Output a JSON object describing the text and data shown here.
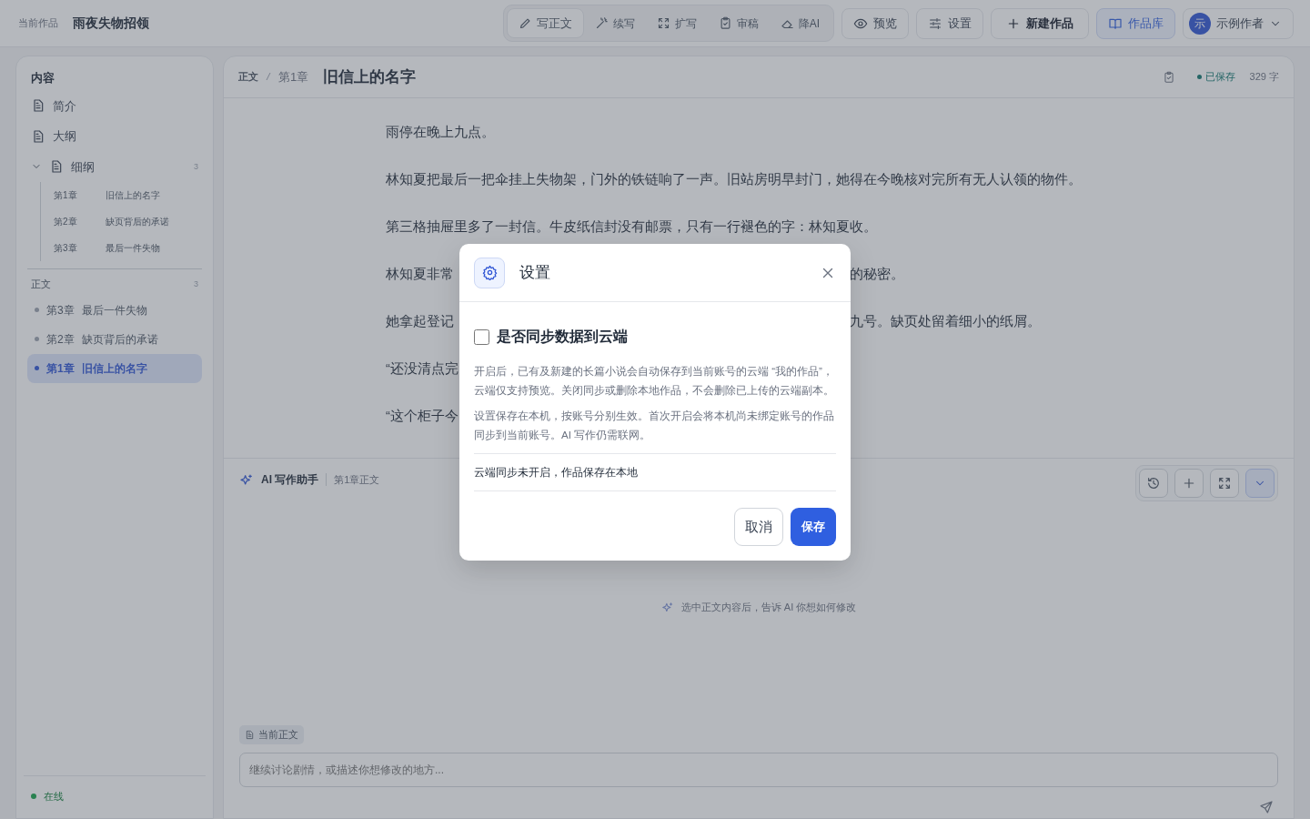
{
  "topbar": {
    "label": "当前作品",
    "work_title": "雨夜失物招领",
    "tools": [
      {
        "label": "写正文",
        "selected": true
      },
      {
        "label": "续写",
        "selected": false
      },
      {
        "label": "扩写",
        "selected": false
      },
      {
        "label": "审稿",
        "selected": false
      },
      {
        "label": "降AI",
        "selected": false
      }
    ],
    "buttons": [
      {
        "label": "预览",
        "kind": "plain"
      },
      {
        "label": "设置",
        "kind": "plain"
      },
      {
        "label": "新建作品",
        "kind": "bold"
      },
      {
        "label": "作品库",
        "kind": "primary"
      }
    ],
    "user": {
      "avatar": "示",
      "name": "示例作者"
    }
  },
  "sidebar": {
    "title": "内容",
    "docs": [
      {
        "label": "简介"
      },
      {
        "label": "大纲"
      }
    ],
    "outline": {
      "label": "细纲",
      "count": "3",
      "expanded": true,
      "children": [
        {
          "chapter": "第1章",
          "title": "旧信上的名字"
        },
        {
          "chapter": "第2章",
          "title": "缺页背后的承诺"
        },
        {
          "chapter": "第3章",
          "title": "最后一件失物"
        }
      ]
    },
    "section": {
      "title": "正文",
      "count": "3",
      "chapters": [
        {
          "chapter": "第3章",
          "title": "最后一件失物",
          "selected": false
        },
        {
          "chapter": "第2章",
          "title": "缺页背后的承诺",
          "selected": false
        },
        {
          "chapter": "第1章",
          "title": "旧信上的名字",
          "selected": true
        }
      ]
    },
    "status": "在线"
  },
  "editor": {
    "breadcrumb": [
      "正文",
      "第1章"
    ],
    "title": "旧信上的名字",
    "saved": "已保存",
    "word_count": "329 字",
    "paragraphs": [
      {
        "left": "雨停在晚上九点。"
      },
      {
        "left": "林知夏把最后一把伞挂上失物架，门外的铁链响了一声。旧站房明早封门，她得在今晚核对完所有无人认领的物件。"
      },
      {
        "left": "第三格抽屉里多了一封信。牛皮纸信封没有邮票，只有一行褪色的字：林知夏收。"
      },
      {
        "left": "林知夏非常",
        "right": "的秘密。"
      },
      {
        "left": "她拿起登记",
        "right": "九号。缺页处留着细小的纸屑。"
      },
      {
        "left": "“还没清点完"
      },
      {
        "left": "“这个柜子今"
      }
    ]
  },
  "assistant": {
    "title": "AI 写作助手",
    "context": "第1章正文",
    "hint": "选中正文内容后，告诉 AI 你想如何修改",
    "chip": "当前正文",
    "placeholder": "继续讨论剧情，或描述你想修改的地方..."
  },
  "modal": {
    "title": "设置",
    "checkbox": {
      "label": "是否同步数据到云端",
      "checked": false
    },
    "descriptions": [
      "开启后，已有及新建的长篇小说会自动保存到当前账号的云端 “我的作品”，云端仅支持预览。关闭同步或删除本地作品，不会删除已上传的云端副本。",
      "设置保存在本机，按账号分别生效。首次开启会将本机尚未绑定账号的作品同步到当前账号。AI 写作仍需联网。"
    ],
    "status": "云端同步未开启，作品保存在本地",
    "cancel": "取消",
    "save": "保存"
  }
}
